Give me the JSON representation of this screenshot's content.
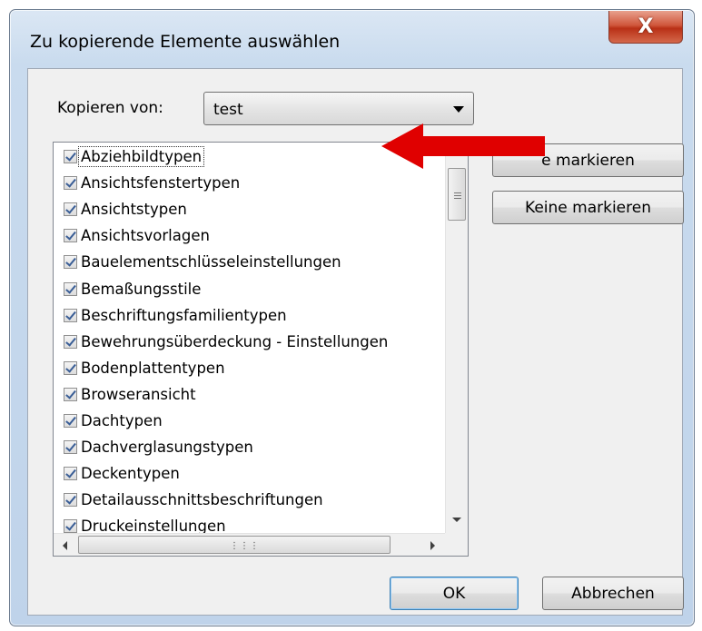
{
  "window": {
    "title": "Zu kopierende Elemente auswählen",
    "close_label": "X"
  },
  "copy_from": {
    "label": "Kopieren von:",
    "selected": "test"
  },
  "items": [
    {
      "label": "Abziehbildtypen",
      "checked": true
    },
    {
      "label": "Ansichtsfenstertypen",
      "checked": true
    },
    {
      "label": "Ansichtstypen",
      "checked": true
    },
    {
      "label": "Ansichtsvorlagen",
      "checked": true
    },
    {
      "label": "Bauelementschlüsseleinstellungen",
      "checked": true
    },
    {
      "label": "Bemaßungsstile",
      "checked": true
    },
    {
      "label": "Beschriftungsfamilientypen",
      "checked": true
    },
    {
      "label": "Bewehrungsüberdeckung - Einstellungen",
      "checked": true
    },
    {
      "label": "Bodenplattentypen",
      "checked": true
    },
    {
      "label": "Browseransicht",
      "checked": true
    },
    {
      "label": "Dachtypen",
      "checked": true
    },
    {
      "label": "Dachverglasungstypen",
      "checked": true
    },
    {
      "label": "Deckentypen",
      "checked": true
    },
    {
      "label": "Detailausschnittsbeschriftungen",
      "checked": true
    },
    {
      "label": "Druckeinstellungen",
      "checked": true
    }
  ],
  "buttons": {
    "select_all": "e markieren",
    "select_none": "Keine markieren",
    "ok": "OK",
    "cancel": "Abbrechen"
  },
  "annotation": {
    "arrow_color": "#e00000"
  }
}
